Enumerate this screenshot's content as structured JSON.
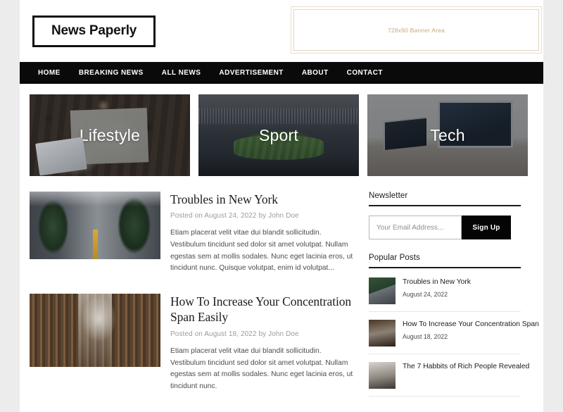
{
  "site": {
    "logo_text": "News Paperly"
  },
  "banner": {
    "text": "728x90 Banner Area",
    "border_color": "#e3d5bd",
    "text_color": "#c9a87c"
  },
  "nav": {
    "background": "#0a0a0a",
    "items": [
      {
        "label": "HOME"
      },
      {
        "label": "BREAKING NEWS"
      },
      {
        "label": "ALL NEWS"
      },
      {
        "label": "ADVERTISEMENT"
      },
      {
        "label": "ABOUT"
      },
      {
        "label": "CONTACT"
      }
    ]
  },
  "categories": [
    {
      "label": "Lifestyle",
      "image": "desk-flatlay-map-laptop-photo"
    },
    {
      "label": "Sport",
      "image": "football-stadium-photo"
    },
    {
      "label": "Tech",
      "image": "desk-imac-laptop-tablet-photo"
    }
  ],
  "articles": [
    {
      "title": "Troubles in New York",
      "meta": "Posted on August 24, 2022 by John Doe",
      "excerpt": "Etiam placerat velit vitae dui blandit sollicitudin. Vestibulum tincidunt sed dolor sit amet volutpat. Nullam egestas sem at mollis sodales. Nunc eget lacinia eros, ut tincidunt nunc. Quisque volutpat, enim id volutpat...",
      "image": "new-york-street-trees-photo"
    },
    {
      "title": "How To Increase Your Concentration Span Easily",
      "meta": "Posted on August 18, 2022 by John Doe",
      "excerpt": "Etiam placerat velit vitae dui blandit sollicitudin. Vestibulum tincidunt sed dolor sit amet volutpat. Nullam egestas sem at mollis sodales. Nunc eget lacinia eros, ut tincidunt nunc.",
      "image": "library-bookshelves-photo"
    }
  ],
  "sidebar": {
    "newsletter": {
      "title": "Newsletter",
      "placeholder": "Your Email Address...",
      "value": "",
      "button_label": "Sign Up",
      "button_color": "#050505"
    },
    "popular": {
      "title": "Popular Posts",
      "items": [
        {
          "title": "Troubles in New York",
          "date": "August 24, 2022",
          "image": "new-york-street-thumb"
        },
        {
          "title": "How To Increase Your Concentration Span",
          "date": "August 18, 2022",
          "image": "library-thumb"
        },
        {
          "title": "The 7 Habbits of Rich People Revealed",
          "date": "",
          "image": "habits-thumb"
        }
      ]
    }
  }
}
